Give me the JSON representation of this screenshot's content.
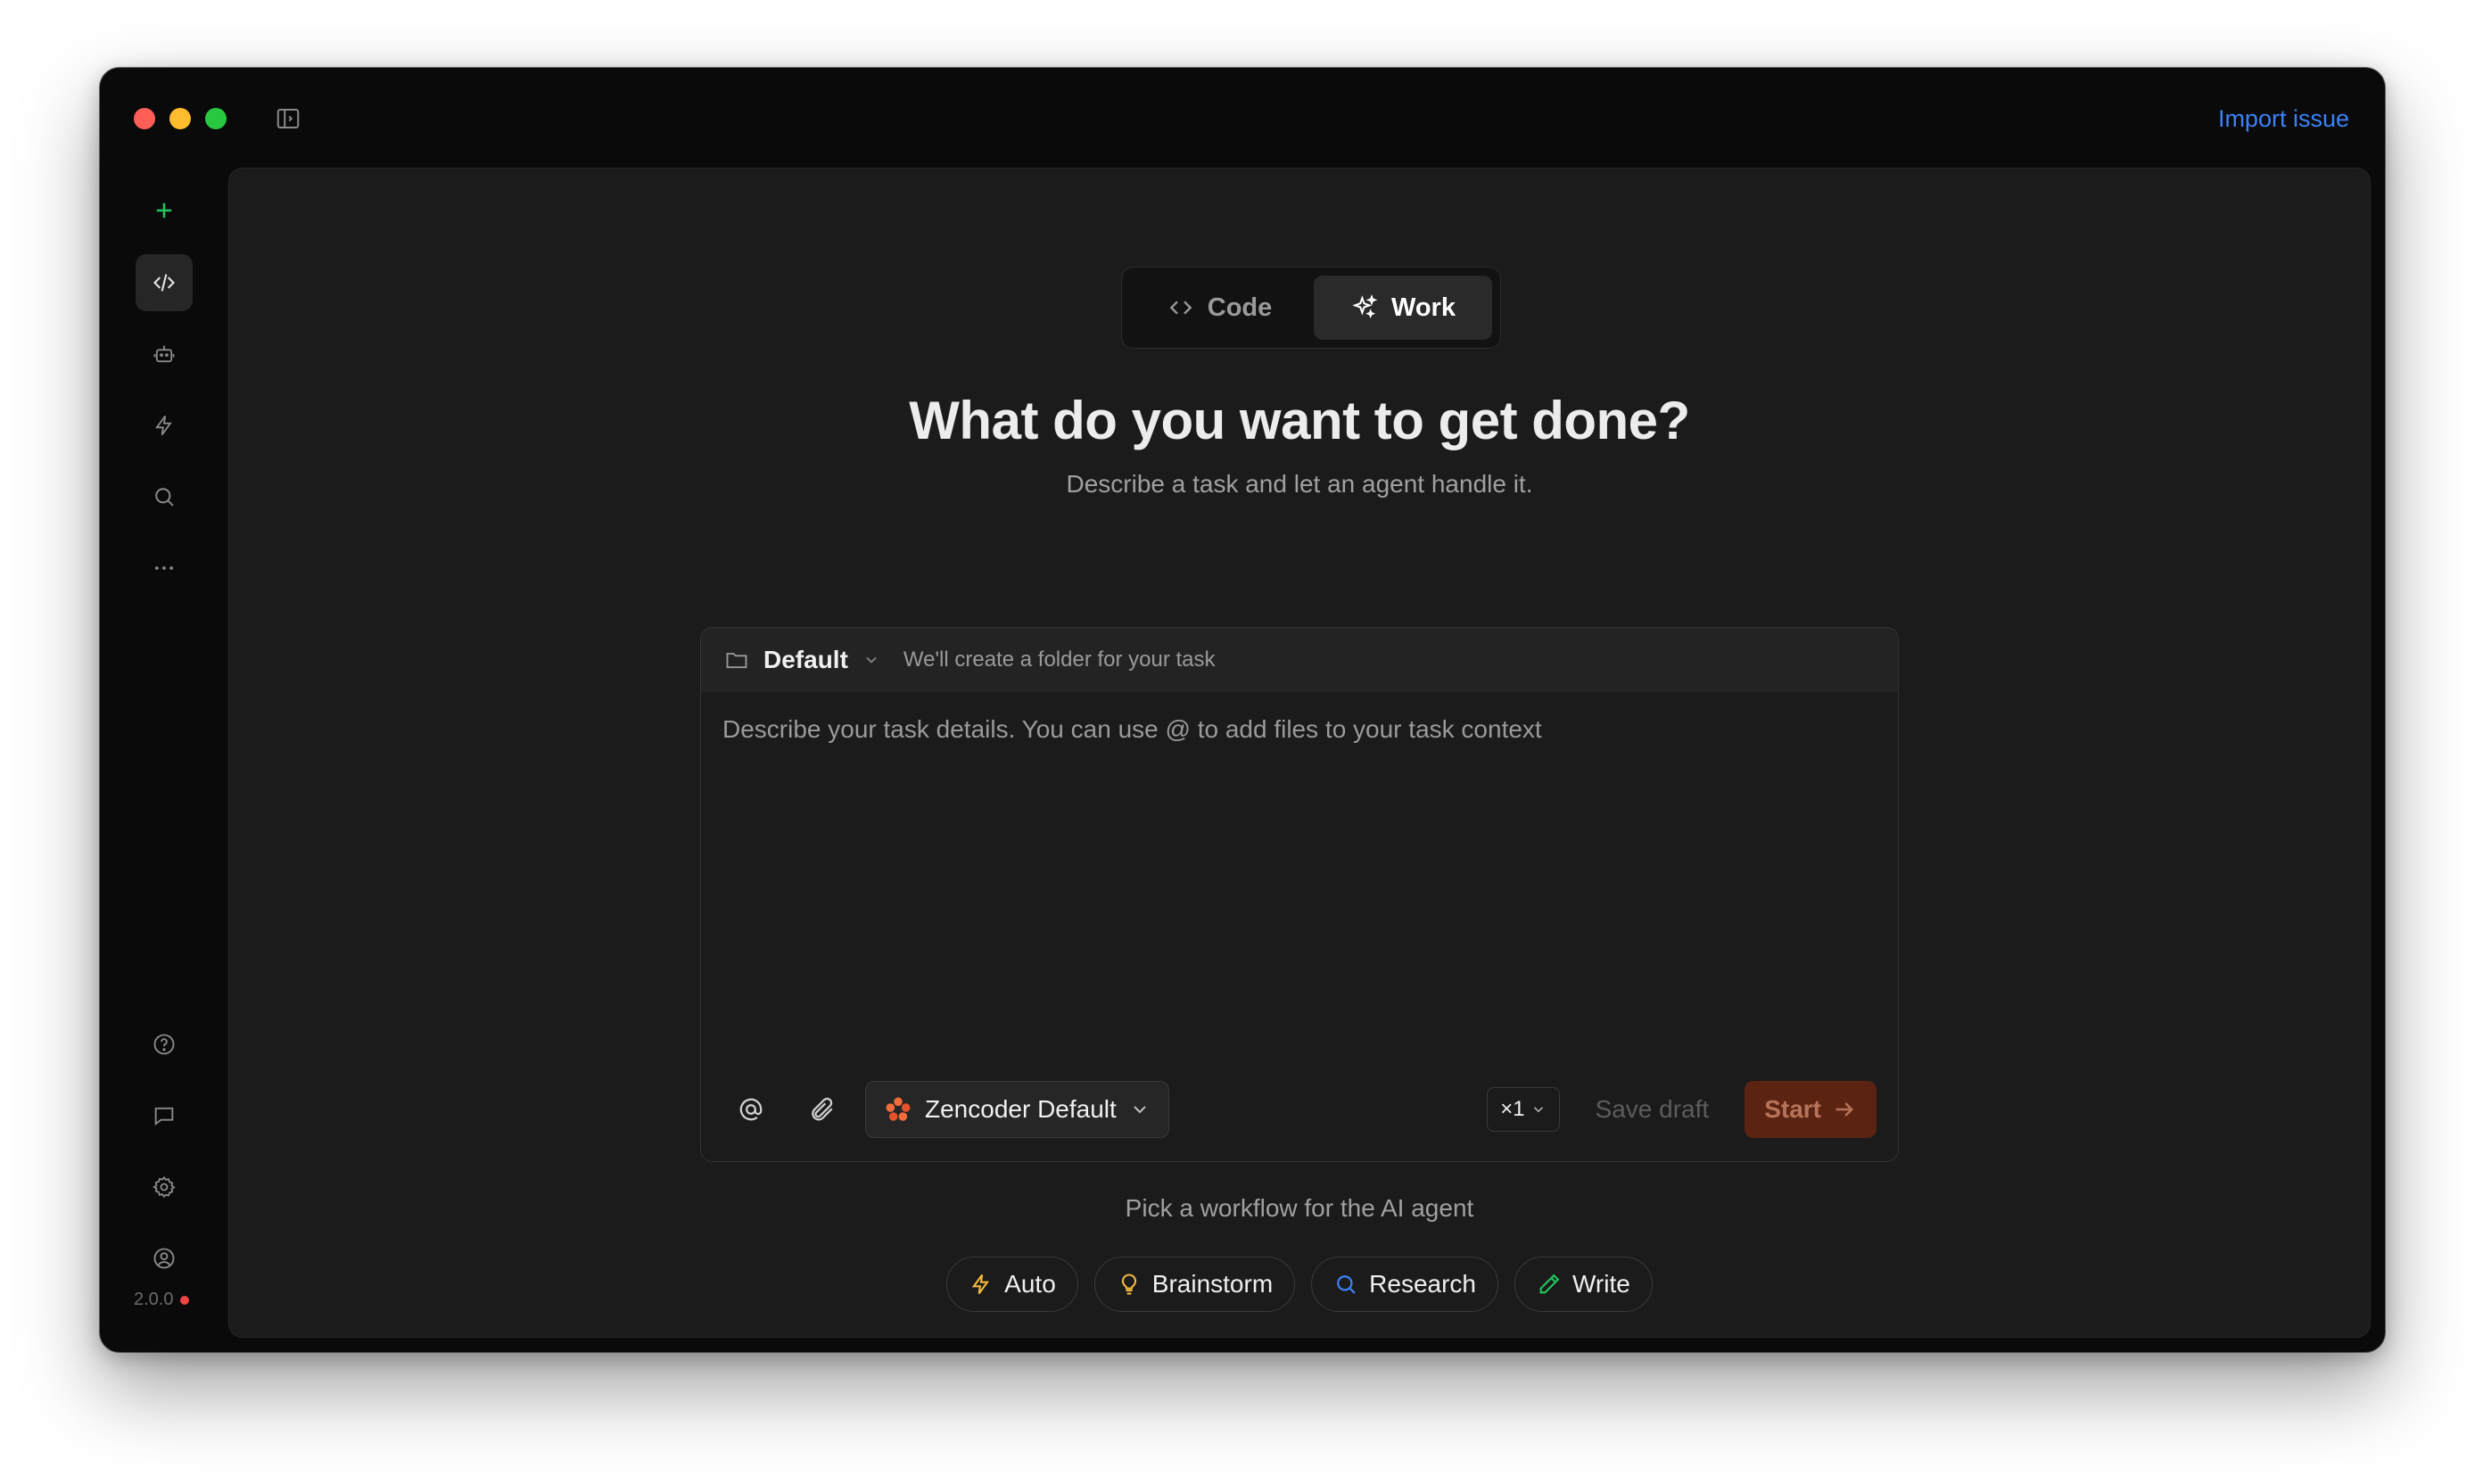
{
  "titlebar": {
    "import_label": "Import issue"
  },
  "sidebar": {
    "items": [
      {
        "icon": "plus-icon"
      },
      {
        "icon": "code-icon",
        "active": true
      },
      {
        "icon": "robot-icon"
      },
      {
        "icon": "lightning-icon"
      },
      {
        "icon": "search-icon"
      },
      {
        "icon": "more-icon"
      }
    ],
    "bottom_items": [
      {
        "icon": "help-icon"
      },
      {
        "icon": "chat-icon"
      },
      {
        "icon": "gear-icon"
      },
      {
        "icon": "user-icon"
      }
    ],
    "version": "2.0.0"
  },
  "mode": {
    "tabs": [
      {
        "label": "Code",
        "active": false
      },
      {
        "label": "Work",
        "active": true
      }
    ]
  },
  "main": {
    "heading": "What do you want to get done?",
    "subheading": "Describe a task and let an agent handle it."
  },
  "composer": {
    "folder": "Default",
    "folder_hint": "We'll create a folder for your task",
    "placeholder": "Describe your task details. You can use @ to add files to your task context",
    "value": "",
    "model": "Zencoder Default",
    "count": "×1",
    "save_draft": "Save draft",
    "start": "Start"
  },
  "workflows": {
    "label": "Pick a workflow for the AI agent",
    "items": [
      {
        "label": "Auto",
        "icon": "lightning-icon",
        "color": "#f5b83d"
      },
      {
        "label": "Brainstorm",
        "icon": "lightbulb-icon",
        "color": "#f5b83d"
      },
      {
        "label": "Research",
        "icon": "search-icon",
        "color": "#3b82f6"
      },
      {
        "label": "Write",
        "icon": "pencil-icon",
        "color": "#22c55e"
      }
    ]
  },
  "colors": {
    "accent_link": "#3b82f6",
    "start_button": "#5b2412",
    "plus_green": "#22c55e"
  }
}
